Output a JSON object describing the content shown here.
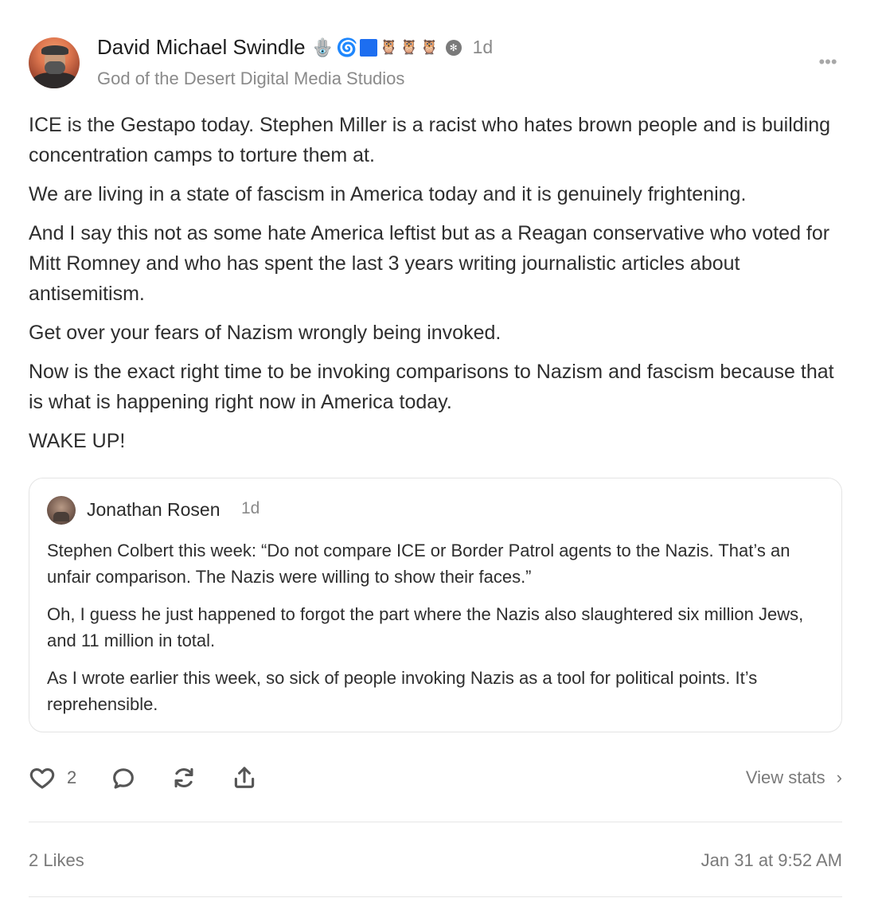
{
  "post": {
    "author_name": "David Michael Swindle",
    "badges": [
      "🪬",
      "🌀",
      "🦉",
      "🦉",
      "🦉"
    ],
    "time": "1d",
    "subtitle": "God of the Desert Digital Media Studios",
    "paragraphs": [
      "ICE is the Gestapo today. Stephen Miller is a racist who hates brown people and is building concentration camps to torture them at.",
      "We are living in a state of fascism in America today and it is genuinely frightening.",
      "And I say this not as some hate America leftist but as a Reagan conservative who voted for Mitt Romney and who has spent the last 3 years writing journalistic articles about antisemitism.",
      "Get over your fears of Nazism wrongly being invoked.",
      "Now is the exact right time to be invoking comparisons to Nazism and fascism because that is what is happening right now in America today.",
      "WAKE UP!"
    ]
  },
  "quote": {
    "author_name": "Jonathan Rosen",
    "time": "1d",
    "paragraphs": [
      "Stephen Colbert this week: “Do not compare ICE or Border Patrol agents to the Nazis. That’s an unfair comparison. The Nazis were willing to show their faces.”",
      "Oh, I guess he just happened to forgot the part where the Nazis also slaughtered six million Jews, and 11 million in total.",
      "As I wrote earlier this week, so sick of people invoking Nazis as a tool for political points. It’s reprehensible."
    ]
  },
  "actions": {
    "like_count": "2",
    "view_stats_label": "View stats"
  },
  "footer": {
    "likes_summary": "2 Likes",
    "timestamp": "Jan 31 at 9:52 AM"
  },
  "colors": {
    "text": "#2e2e2e",
    "muted": "#8a8a8a",
    "border": "#e4e4e4",
    "badge_square": "#1d6ef0"
  }
}
